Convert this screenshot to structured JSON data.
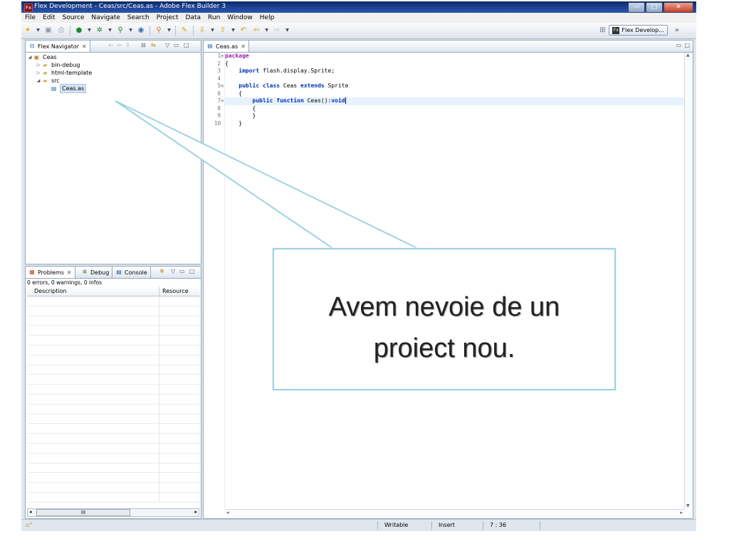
{
  "window": {
    "title": "Flex Development - Ceas/src/Ceas.as - Adobe Flex Builder 3",
    "app_icon": "Fx",
    "buttons": {
      "minimize": "—",
      "maximize": "□",
      "close": "✕"
    }
  },
  "menu": [
    "File",
    "Edit",
    "Source",
    "Navigate",
    "Search",
    "Project",
    "Data",
    "Run",
    "Window",
    "Help"
  ],
  "perspective": {
    "label": "Flex Develop...",
    "chevron": "»"
  },
  "navigator": {
    "tab_label": "Flex Navigator",
    "tab_close": "✕",
    "tree": [
      {
        "label": "Ceas",
        "level": 0,
        "icon": "project-icon",
        "expanded": true
      },
      {
        "label": "bin-debug",
        "level": 1,
        "icon": "folder-icon",
        "expanded": false
      },
      {
        "label": "html-template",
        "level": 1,
        "icon": "folder-icon",
        "expanded": false
      },
      {
        "label": "src",
        "level": 1,
        "icon": "source-folder-icon",
        "expanded": true
      },
      {
        "label": "Ceas.as",
        "level": 2,
        "icon": "actionscript-file-icon",
        "selected": true
      }
    ]
  },
  "bottom_panel": {
    "tabs": [
      "Problems",
      "Debug",
      "Console"
    ],
    "summary": "0 errors, 0 warnings, 0 infos",
    "columns": [
      "Description",
      "Resource"
    ],
    "scroll_thumb": "III"
  },
  "editor": {
    "tab_label": "Ceas.as",
    "lines": [
      {
        "n": "1",
        "text": "package"
      },
      {
        "n": "2",
        "text": "{"
      },
      {
        "n": "3",
        "text": "    import flash.display.Sprite;"
      },
      {
        "n": "4",
        "text": ""
      },
      {
        "n": "5",
        "text": "    public class Ceas extends Sprite"
      },
      {
        "n": "6",
        "text": "    {"
      },
      {
        "n": "7",
        "text": "        public function Ceas():void"
      },
      {
        "n": "8",
        "text": "        {"
      },
      {
        "n": "9",
        "text": "        }"
      },
      {
        "n": "10",
        "text": "    }"
      }
    ]
  },
  "status": {
    "writable": "Writable",
    "insert": "Insert",
    "position": "7 : 36"
  },
  "callout": {
    "text": "Avem nevoie de un\nproiect nou."
  },
  "colors": {
    "keyword": "#0033b3",
    "package_keyword": "#9a1ca8",
    "callout_border": "#9fd3e2",
    "titlebar": "#1b3d8a"
  }
}
